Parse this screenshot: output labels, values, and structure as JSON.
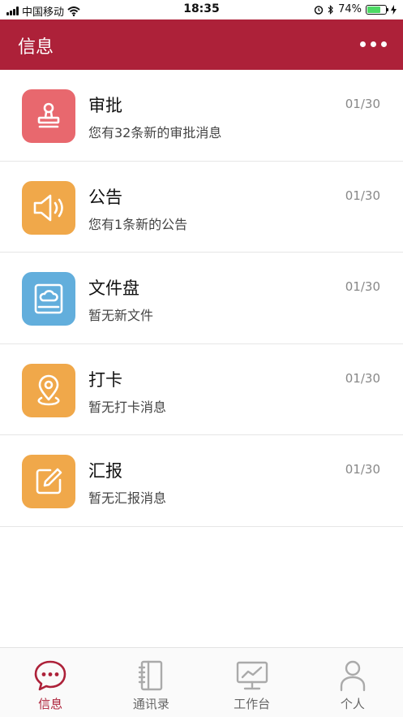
{
  "status_bar": {
    "carrier": "中国移动",
    "time": "18:35",
    "battery": "74%"
  },
  "header": {
    "title": "信息"
  },
  "messages": [
    {
      "title": "审批",
      "subtitle": "您有32条新的审批消息",
      "date": "01/30",
      "icon": "stamp-icon",
      "color": "#e8686e"
    },
    {
      "title": "公告",
      "subtitle": "您有1条新的公告",
      "date": "01/30",
      "icon": "speaker-icon",
      "color": "#f0a84a"
    },
    {
      "title": "文件盘",
      "subtitle": "暂无新文件",
      "date": "01/30",
      "icon": "cloud-drive-icon",
      "color": "#62aedc"
    },
    {
      "title": "打卡",
      "subtitle": "暂无打卡消息",
      "date": "01/30",
      "icon": "location-pin-icon",
      "color": "#f0a84a"
    },
    {
      "title": "汇报",
      "subtitle": "暂无汇报消息",
      "date": "01/30",
      "icon": "edit-icon",
      "color": "#f0a84a"
    }
  ],
  "tabs": [
    {
      "label": "信息",
      "icon": "chat-bubble-icon",
      "active": true
    },
    {
      "label": "通讯录",
      "icon": "address-book-icon",
      "active": false
    },
    {
      "label": "工作台",
      "icon": "monitor-icon",
      "active": false
    },
    {
      "label": "个人",
      "icon": "person-icon",
      "active": false
    }
  ],
  "colors": {
    "brand": "#ad2139",
    "active_tab": "#ad2139",
    "inactive_tab": "#666666"
  }
}
